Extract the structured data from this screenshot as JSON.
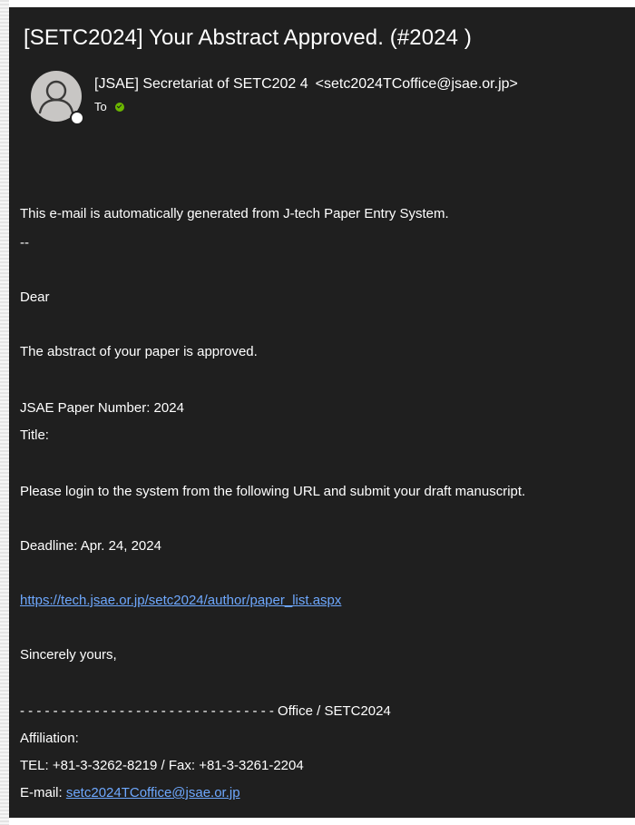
{
  "email": {
    "subject": "[SETC2024] Your Abstract Approved. (#2024        )",
    "sender_name": "[JSAE] Secretariat of SETC202 4",
    "sender_email": "<setc2024TCoffice@jsae.or.jp>",
    "to_label": "To",
    "avatar_icon": "person-icon",
    "colors": {
      "background": "#1f1f1f",
      "text": "#ffffff",
      "link": "#6ea8fe",
      "status_green": "#6bb700"
    }
  },
  "body": {
    "line_intro": "This e-mail is automatically generated from J-tech Paper Entry System.",
    "line_separator": "--",
    "line_dear": "Dear",
    "line_approved": "The abstract of your paper is approved.",
    "line_paper_number": "JSAE Paper Number: 2024",
    "line_title": "Title:",
    "line_login": "Please login to the system from the following URL and submit your draft manuscript.",
    "line_deadline": "Deadline: Apr. 24, 2024",
    "link_url": "https://tech.jsae.or.jp/setc2024/author/paper_list.aspx",
    "line_closing": "Sincerely yours,",
    "signature_dashes": "- - - - - - - - - - - - - - - - - - - - - - - - - - - - - - - Office / SETC2024",
    "line_affiliation": "Affiliation:",
    "line_tel_fax": "TEL: +81-3-3262-8219 / Fax: +81-3-3261-2204",
    "email_label": "E-mail: ",
    "email_link": "setc2024TCoffice@jsae.or.jp"
  }
}
